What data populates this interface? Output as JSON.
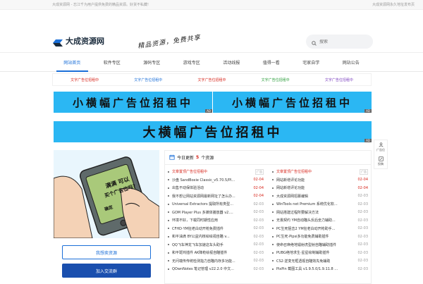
{
  "topbar": {
    "left": "大成资源网 - 忘江千为用户提供免费的精品资源。好货不私藏!",
    "right": "大成资源网永久地址发布页"
  },
  "header": {
    "logo_text": "大成资源网",
    "slogan": "精品资源，免费共享",
    "search_placeholder": "搜索"
  },
  "nav": {
    "items": [
      "网站首页",
      "软件专区",
      "源码专区",
      "游戏专区",
      "活动线报",
      "值得一看",
      "宅家自学",
      "网站公告"
    ]
  },
  "text_ads": {
    "items": [
      {
        "label": "文字广告位招租中",
        "color": "#d7261c"
      },
      {
        "label": "文字广告位招租中",
        "color": "#1b6fd8"
      },
      {
        "label": "文字广告位招租中",
        "color": "#d7261c"
      },
      {
        "label": "文字广告位招租中",
        "color": "#2a9d3a"
      },
      {
        "label": "文字广告位招租中",
        "color": "#7b3fbf"
      }
    ]
  },
  "banners": {
    "small_left": "小横幅广告位招租中",
    "small_right": "小横幅广告位招租中",
    "big": "大横幅广告位招租中",
    "ad_tag": "AD"
  },
  "promo": {
    "phone_text_1": "满满 可以",
    "phone_text_2": "买个广告位吗?",
    "phone_text_3": "确定",
    "btn_outline": "我想卖资源",
    "btn_solid": "加入交流群"
  },
  "panel": {
    "title_prefix": "今日更新",
    "title_count": "5",
    "title_suffix": "个资源",
    "left": [
      {
        "title": "文章置顶广告位招租中",
        "date": "广告",
        "red": true,
        "badge": true
      },
      {
        "title": "沙盘 SandBoxie Classic_v5.70.5/Pl...",
        "date": "02-04",
        "red_date": true
      },
      {
        "title": "出售不动保体验活动",
        "date": "02-04",
        "red_date": true
      },
      {
        "title": "我不想让网站资源网最新网址了怎么办...",
        "date": "02-04",
        "red_date": true
      },
      {
        "title": "Universal Extractors 提取所有类型...",
        "date": "02-03"
      },
      {
        "title": "GOM Player Plus 多媒体播放器 v2....",
        "date": "02-03"
      },
      {
        "title": "环境不好，下载同时期性应用",
        "date": "02-03"
      },
      {
        "title": "CFHD·YM狂老白动开枪免费插件",
        "date": "02-03"
      },
      {
        "title": "和平油滴 BY公益内核绘绘视自瞄 v...",
        "date": "02-03"
      },
      {
        "title": "QQ飞车神龙飞车加速这车头助手",
        "date": "02-03"
      },
      {
        "title": "和平斑鸠插件 AK降枪绘视自瞄插件",
        "date": "02-03"
      },
      {
        "title": "无问端传传统检测指力自瞄内存多功能...",
        "date": "02-03"
      },
      {
        "title": "QOwnNotes 笔记管理 v22.2.0 中文...",
        "date": "02-03"
      }
    ],
    "right": [
      {
        "title": "文章置顶广告位招租中",
        "date": "广告",
        "red": true,
        "badge": true
      },
      {
        "title": "网站新增评论功能",
        "date": "02-04",
        "red_date": true
      },
      {
        "title": "网站新增评论功能",
        "date": "02-04",
        "red_date": true
      },
      {
        "title": "大成资源网招募编辑",
        "date": "02-03"
      },
      {
        "title": "WinTools net Premium 系统优化软...",
        "date": "02-03"
      },
      {
        "title": "网站搭建过程所要解决方法",
        "date": "02-03"
      },
      {
        "title": "无畏契约 YM自动瞄头反后坐力辅助...",
        "date": "02-03"
      },
      {
        "title": "PC生死狙击2 YM狂老白动开枪助手...",
        "date": "02-03"
      },
      {
        "title": "PC生死·Pipsi多功能免费辅助插件",
        "date": "02-03"
      },
      {
        "title": "使命召唤绝地镭射虎型射自瞄辅助插件",
        "date": "02-03"
      },
      {
        "title": "PUBG绝地求生·星星绘制辅助插件",
        "date": "02-03"
      },
      {
        "title": "CS2·逆变无框透视自瞄效先免辅助",
        "date": "02-03"
      },
      {
        "title": "PixPin 截图工具 v1.9.5.0/1.9.11.8 ...",
        "date": "02-03"
      }
    ]
  },
  "side_float": {
    "item1": "广告位",
    "item2": "投稿"
  }
}
